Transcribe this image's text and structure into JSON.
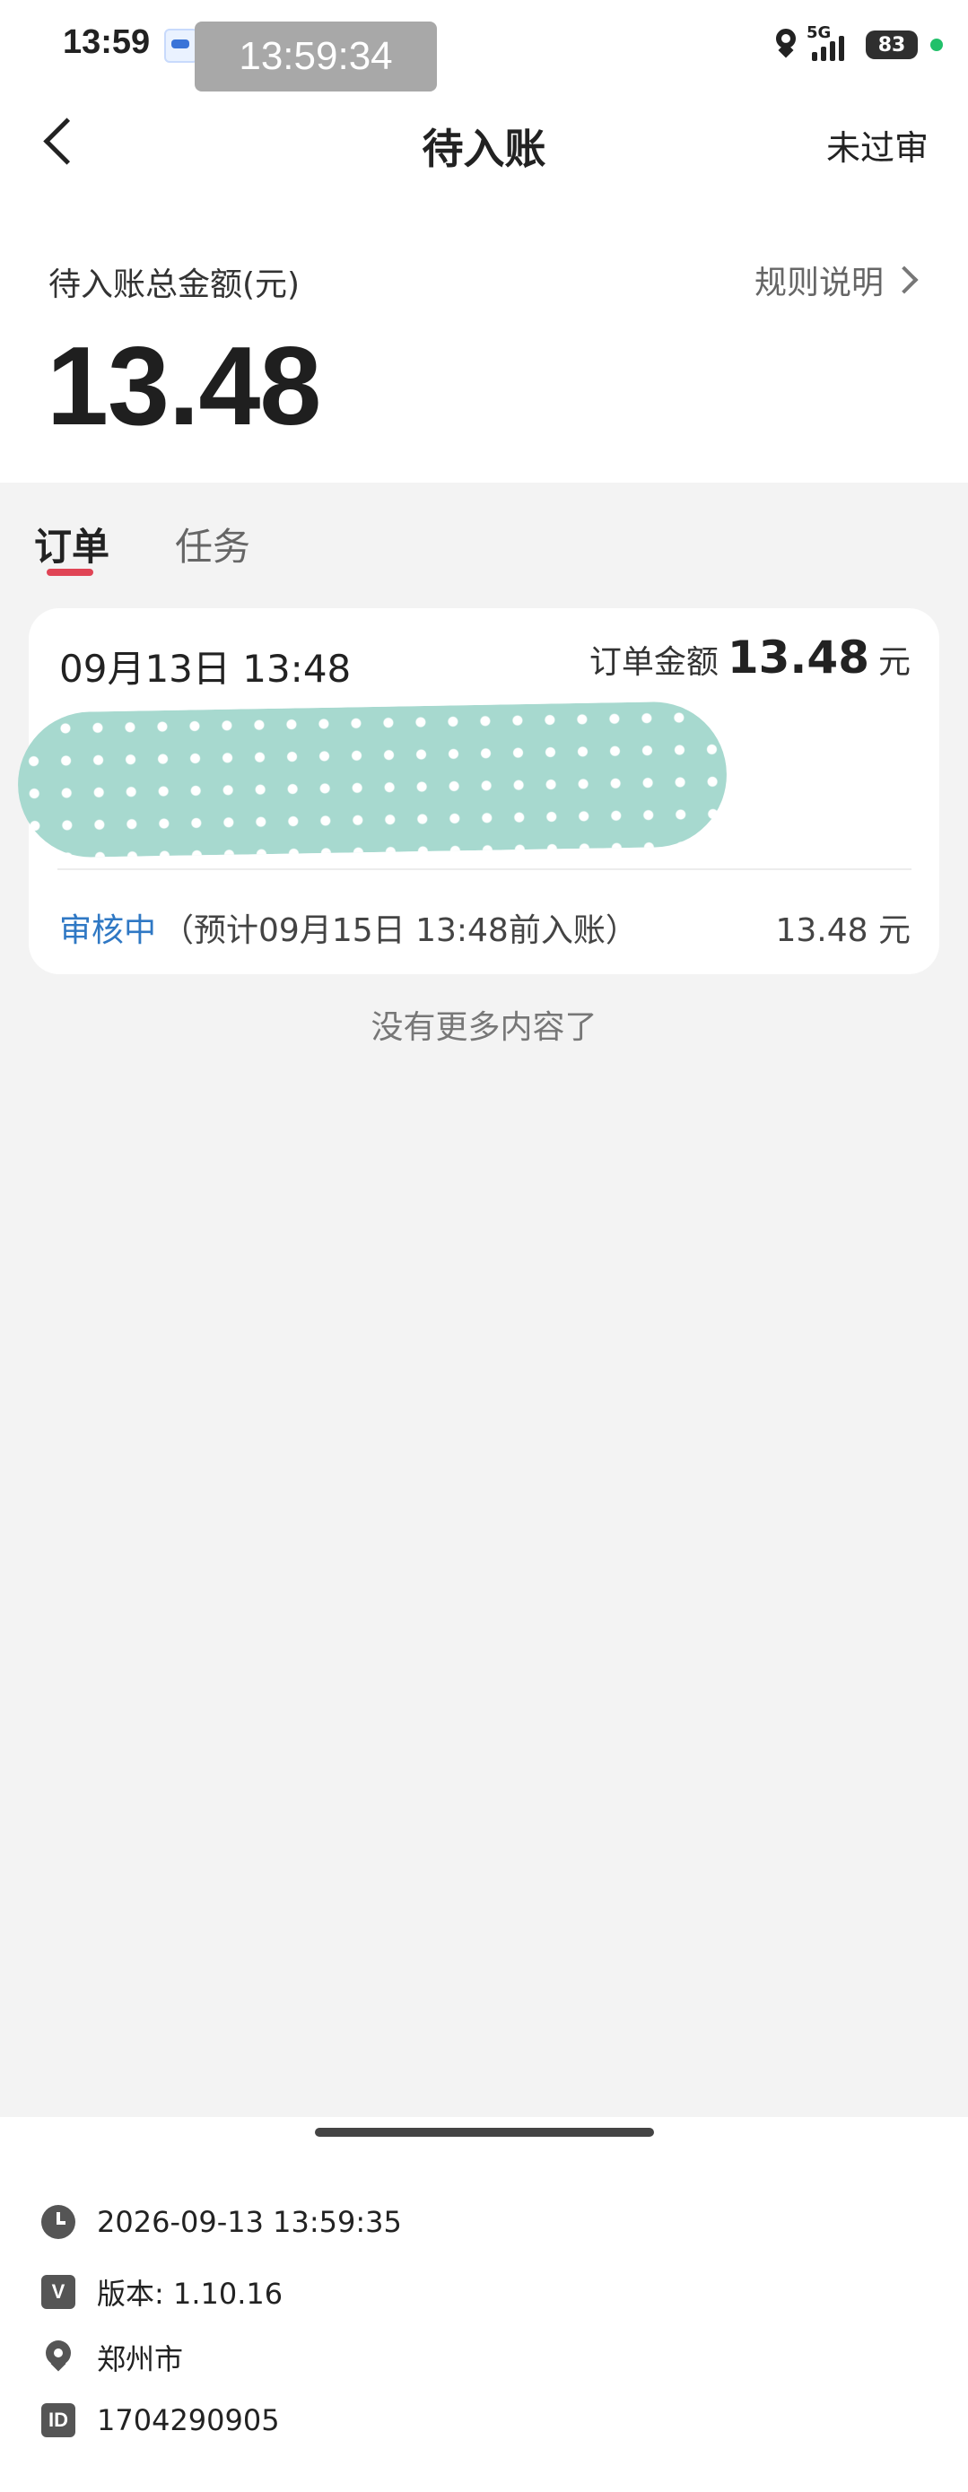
{
  "status_bar": {
    "time": "13:59",
    "overlay_time": "13:59:34",
    "network": "5G",
    "battery": "83"
  },
  "header": {
    "title": "待入账",
    "right_label": "未过审"
  },
  "summary": {
    "label": "待入账总金额(元)",
    "rules_label": "规则说明",
    "total": "13.48"
  },
  "tabs": [
    {
      "label": "订单",
      "active": true
    },
    {
      "label": "任务",
      "active": false
    }
  ],
  "order": {
    "date": "09月13日 13:48",
    "amount_label": "订单金额",
    "amount": "13.48",
    "unit": "元",
    "status": "审核中",
    "note": "（预计09月15日 13:48前入账）",
    "right_amount": "13.48 元"
  },
  "footer": {
    "no_more": "没有更多内容了"
  },
  "info": {
    "datetime": "2026-09-13 13:59:35",
    "version": "版本: 1.10.16",
    "city": "郑州市",
    "id_badge": "ID",
    "id": "1704290905",
    "version_badge": "V"
  },
  "icons": {
    "back": "back-arrow-icon",
    "chevron": "chevron-right-icon",
    "clock": "clock-icon",
    "location": "location-pin-icon"
  },
  "colors": {
    "accent": "#e04455",
    "status_blue": "#2f78c4",
    "redaction": "#a7d9cf"
  }
}
